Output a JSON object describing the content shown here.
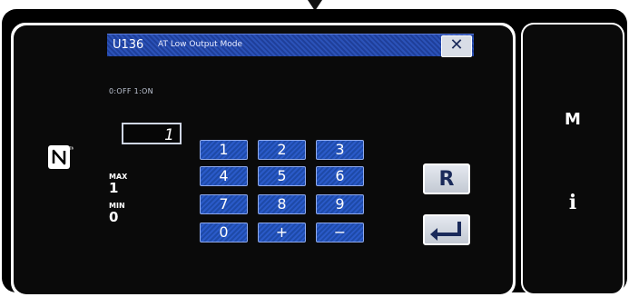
{
  "title_bar": {
    "code": "U136",
    "text": "AT Low Output Mode",
    "close_glyph": "✕"
  },
  "hint": "0:OFF 1:ON",
  "input": {
    "value": "1"
  },
  "limits": {
    "max_label": "MAX",
    "max_value": "1",
    "min_label": "MIN",
    "min_value": "0"
  },
  "keypad": [
    "1",
    "2",
    "3",
    "4",
    "5",
    "6",
    "7",
    "8",
    "9",
    "0",
    "+",
    "−"
  ],
  "buttons": {
    "reset": "R"
  },
  "side_panel": {
    "menu": "M",
    "info": "i"
  },
  "colors": {
    "accent": "#2a5ac8",
    "screen_bg": "#0a0a0a"
  },
  "icons": [
    "nfc-icon",
    "close-icon",
    "enter-icon"
  ]
}
